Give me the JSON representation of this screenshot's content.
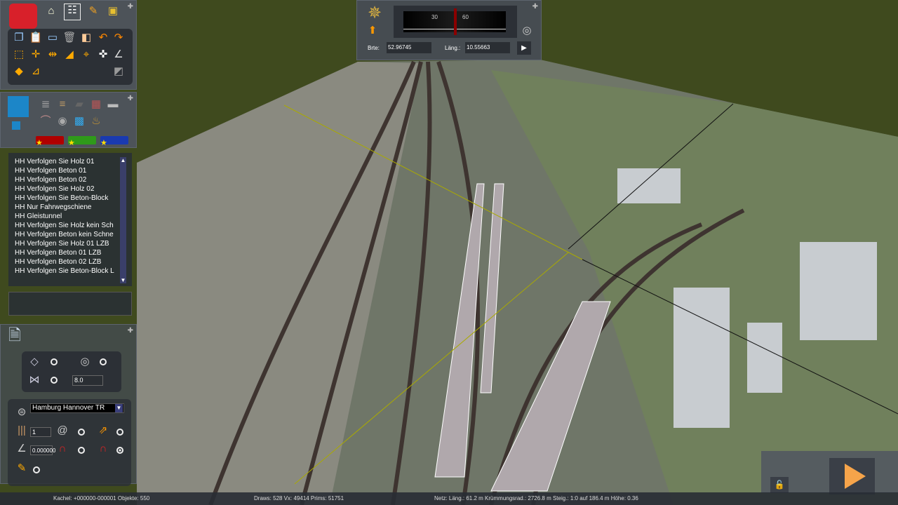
{
  "toolbox": {
    "icons": [
      "toolbox-icon",
      "home-icon",
      "track-icon",
      "brush-icon",
      "train-icon"
    ],
    "tools": [
      "copy-icon",
      "paste-icon",
      "monitor-icon",
      "trash-icon",
      "measure-icon",
      "undo-icon",
      "redo-icon",
      "select-icon",
      "split-icon",
      "join-icon",
      "rail-lift-icon",
      "origin-icon",
      "crosshair-icon",
      "angle-icon",
      "fill-icon",
      "gradient-icon",
      "spotlight-icon"
    ]
  },
  "objects": {
    "icons": [
      "track-list-icon",
      "rails-icon",
      "road-icon",
      "brick-icon",
      "stone-icon",
      "bridge-icon",
      "tunnel-icon",
      "water-icon",
      "sack-icon"
    ],
    "favorites": [
      "#b00000",
      "#2f9a1a",
      "#1a3ab0"
    ]
  },
  "track_list": {
    "items": [
      "HH Verfolgen Sie Holz 01",
      "HH Verfolgen Beton 01",
      "HH Verfolgen Beton 02",
      "HH Verfolgen Sie Holz 02",
      "HH Verfolgen Sie Beton-Block",
      "HH Nur Fahrwegschiene",
      "HH Gleistunnel",
      "HH Verfolgen Sie Holz kein Sch",
      "HH Verfolgen Beton kein Schne",
      "HH Verfolgen Sie Holz 01 LZB",
      "HH Verfolgen Beton 01 LZB",
      "HH Verfolgen Beton 02 LZB",
      "HH Verfolgen Sie Beton-Block L"
    ]
  },
  "compass": {
    "scale_labels": [
      "30",
      "60"
    ],
    "lat_label": "Brte:",
    "lat_value": "52.96745",
    "lon_label": "Läng.:",
    "lon_value": "10.55663"
  },
  "properties": {
    "spacing_value": "8.0",
    "route": "Hamburg Hannover TR",
    "track_count": "1",
    "angle": "0.000000"
  },
  "status": {
    "tile": "Kachel: +000000-000001  Objekte: 550",
    "draws": "Draws: 528 Vx: 49414 Prims: 51751",
    "net": "Netz:  Läng.:   61.2 m Krümmungsrad.: 2726.8 m Steig.: 1:0 auf 186.4 m Höhe:   0.36"
  }
}
